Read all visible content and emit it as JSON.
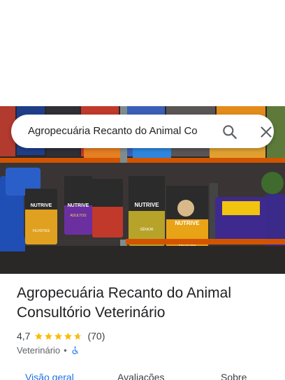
{
  "search": {
    "query": "Agropecuária Recanto do Animal Co"
  },
  "icons": {
    "search": "search-icon",
    "close": "close-icon",
    "wheelchair": "wheelchair-icon",
    "star": "star-icon"
  },
  "place": {
    "title_line1": "Agropecuária Recanto do Animal",
    "title_line2": "Consultório Veterinário",
    "rating": "4,7",
    "stars": 4.7,
    "review_count": "(70)",
    "category": "Veterinário",
    "separator": "•"
  },
  "photo": {
    "bag_labels": [
      "NUTRIVE",
      "NUTRIVE",
      "NUTRIVE",
      "NUTRIVE"
    ],
    "bag_sublabels": [
      "FILHOTES",
      "ADULTOS",
      "SÊNIOR",
      "FILHOTES"
    ]
  },
  "tabs": [
    {
      "label": "Visão geral",
      "active": true
    },
    {
      "label": "Avaliações",
      "active": false
    },
    {
      "label": "Sobre",
      "active": false
    }
  ],
  "colors": {
    "accent": "#1a73e8",
    "star": "#fbbc04",
    "accessibility": "#1a73e8"
  }
}
